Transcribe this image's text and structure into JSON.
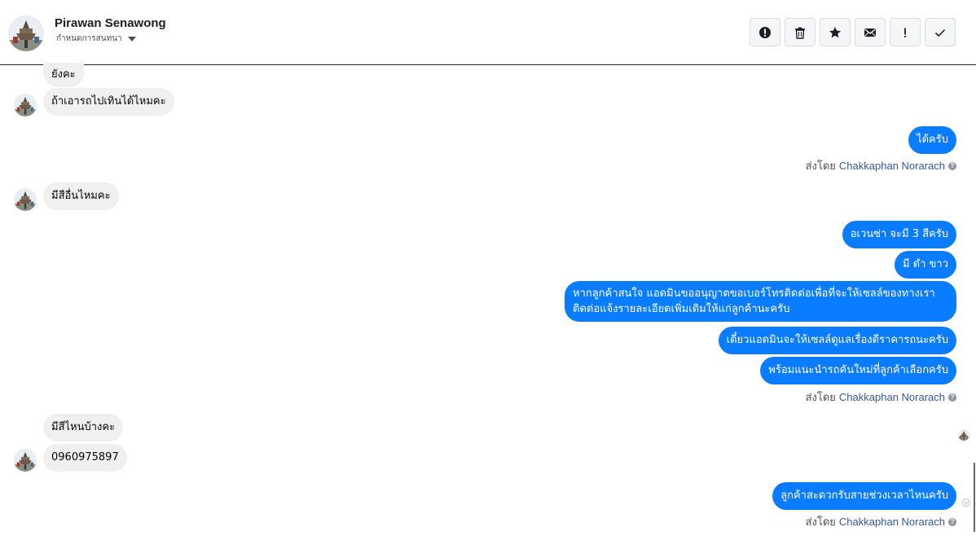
{
  "header": {
    "contact_name": "Pirawan Senawong",
    "subtitle": "กำหนดการสนทนา",
    "actions": [
      {
        "name": "report-button",
        "icon": "alert-circle-icon"
      },
      {
        "name": "delete-button",
        "icon": "trash-icon"
      },
      {
        "name": "star-button",
        "icon": "star-icon"
      },
      {
        "name": "mark-unread-button",
        "icon": "envelope-icon"
      },
      {
        "name": "priority-button",
        "icon": "exclamation-icon"
      },
      {
        "name": "mark-done-button",
        "icon": "check-icon"
      }
    ]
  },
  "messages": {
    "m0": "ยังคะ",
    "m1": "ถ้าเอารถไปเทินได้ไหมคะ",
    "m2": "ได้ครับ",
    "m3": "มีสีอื่นไหมคะ",
    "m4": "อเวนซ่า จะมี 3 สีครับ",
    "m5": "มี ดำ ขาว",
    "m6_line1": "หากลูกค้าสนใจ แอดมินขออนุญาตขอเบอร์โทรติดต่อเพื่อที่จะให้เซลล์ของทางเรา",
    "m6_line2": "ติดต่อแจ้งรายละเอียดเพิ่มเติมให้แก่ลูกค้านะครับ",
    "m7": "เดี๋ยวแอดมินจะให้เซลล์ดูแลเรื่องดีราคารถนะครับ",
    "m8": "พร้อมแนะนำรถคันใหม่ที่ลูกค้าเลือกครับ",
    "m9": "มีสีไหนบ้างคะ",
    "m10": "0960975897",
    "m11": "ลูกค้าสะดวกรับสายช่วงเวลาไหนครับ"
  },
  "sent_by": {
    "prefix": "ส่งโดย",
    "name": "Chakkaphan Norarach",
    "help": "?"
  },
  "colors": {
    "outgoing_bubble": "#0a7cff",
    "incoming_bubble": "#f0f0f0",
    "sender_link": "#365899"
  }
}
